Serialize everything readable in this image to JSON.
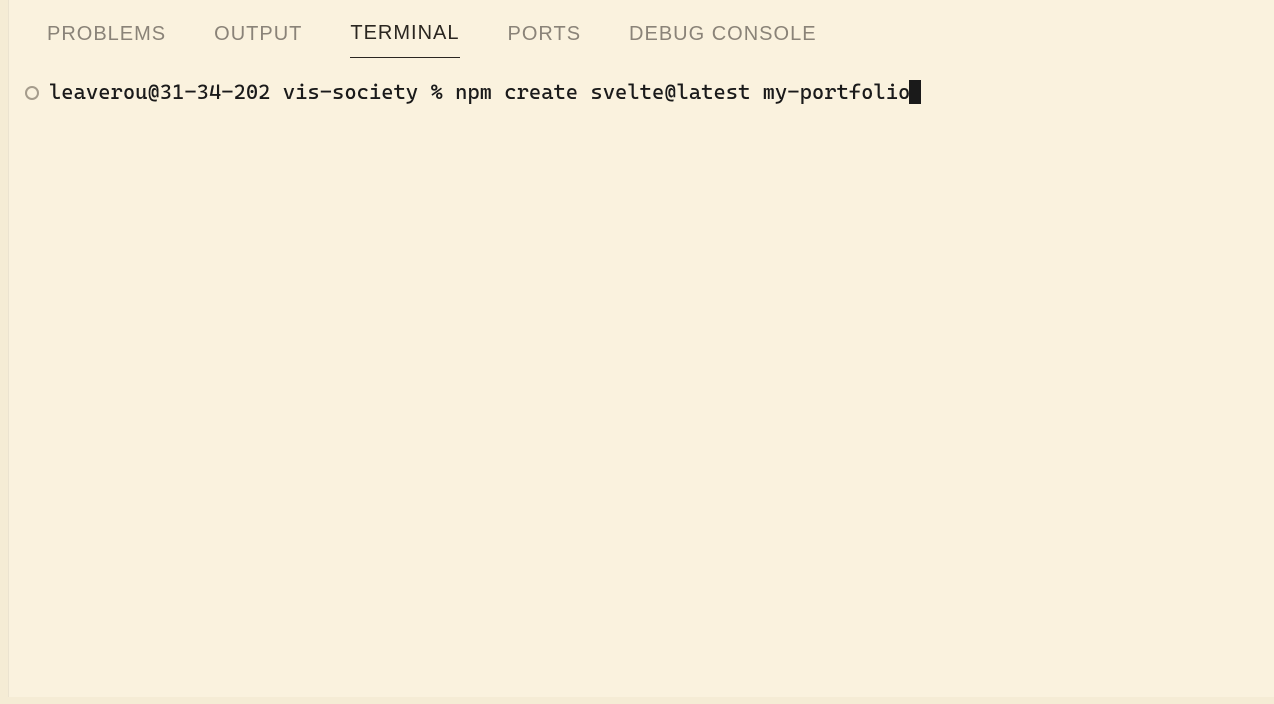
{
  "tabs": {
    "problems": "PROBLEMS",
    "output": "OUTPUT",
    "terminal": "TERMINAL",
    "ports": "PORTS",
    "debug_console": "DEBUG CONSOLE"
  },
  "terminal": {
    "prompt": "leaverou@31-34-202 vis-society % ",
    "command": "npm create svelte@latest my-portfolio"
  }
}
